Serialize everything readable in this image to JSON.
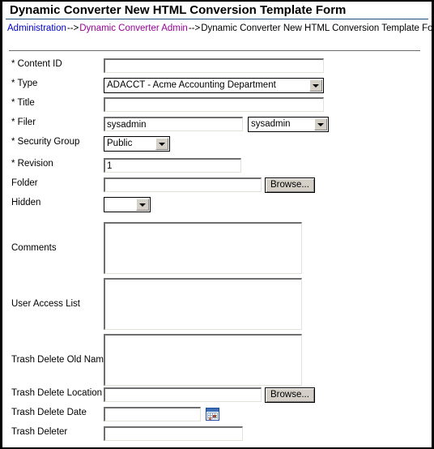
{
  "window": {
    "title": "Dynamic Converter New HTML Conversion Template Form",
    "accent_rule_color": "#1f4e79"
  },
  "breadcrumb": {
    "items": [
      {
        "label": "Administration",
        "state": "link",
        "color": "#0000cc"
      },
      {
        "label": "Dynamic Converter Admin",
        "state": "visited",
        "color": "#990099"
      },
      {
        "label": "Dynamic Converter New HTML Conversion Template Form",
        "state": "current",
        "color": "#000000"
      }
    ],
    "separator": "-->"
  },
  "form": {
    "required_marker": "*",
    "fields": [
      {
        "label": "* Content ID",
        "name": "content-id",
        "type": "text",
        "value": "",
        "placeholder": ""
      },
      {
        "label": "* Type",
        "name": "type",
        "type": "select",
        "value": "ADACCT - Acme Accounting Department"
      },
      {
        "label": "* Title",
        "name": "title",
        "type": "text",
        "value": "",
        "placeholder": ""
      },
      {
        "label": "* Filer",
        "name": "filer",
        "type": "text",
        "value": "sysadmin"
      },
      {
        "label": "* Filer",
        "name": "filer-select",
        "type": "select",
        "value": "sysadmin"
      },
      {
        "label": "* Security Group",
        "name": "security-group",
        "type": "select",
        "value": "Public"
      },
      {
        "label": "* Revision",
        "name": "revision",
        "type": "text",
        "value": "1"
      },
      {
        "label": "Folder",
        "name": "folder",
        "type": "text",
        "value": "",
        "button": "Browse..."
      },
      {
        "label": "Hidden",
        "name": "hidden",
        "type": "select",
        "value": ""
      },
      {
        "label": "Comments",
        "name": "comments",
        "type": "textarea",
        "value": ""
      },
      {
        "label": "User Access List",
        "name": "user-access-list",
        "type": "textarea",
        "value": ""
      },
      {
        "label": "Trash Delete Old Name",
        "name": "trash-delete-old-name",
        "type": "textarea",
        "value": ""
      },
      {
        "label": "Trash Delete Location",
        "name": "trash-delete-location",
        "type": "text",
        "value": "",
        "button": "Browse..."
      },
      {
        "label": "Trash Delete Date",
        "name": "trash-delete-date",
        "type": "text",
        "value": "",
        "icon": "calendar-icon"
      },
      {
        "label": "Trash Deleter",
        "name": "trash-deleter",
        "type": "text",
        "value": ""
      }
    ]
  },
  "labels": {
    "content_id": "* Content ID",
    "type": "* Type",
    "title": "* Title",
    "filer": "* Filer",
    "security_group": "* Security Group",
    "revision": "* Revision",
    "folder": "Folder",
    "hidden": "Hidden",
    "comments": "Comments",
    "user_access_list": "User Access List",
    "trash_delete_old_name": "Trash Delete Old Name",
    "trash_delete_location": "Trash Delete Location",
    "trash_delete_date": "Trash Delete Date",
    "trash_deleter": "Trash Deleter"
  },
  "values": {
    "content_id": "",
    "type": "ADACCT - Acme Accounting Department",
    "title": "",
    "filer_text": "sysadmin",
    "filer_select": "sysadmin",
    "security_group": "Public",
    "revision": "1",
    "folder": "",
    "hidden": "",
    "comments": "",
    "user_access_list": "",
    "trash_delete_old_name": "",
    "trash_delete_location": "",
    "trash_delete_date": "",
    "trash_deleter": ""
  },
  "buttons": {
    "browse_folder": "Browse...",
    "browse_trash_location": "Browse..."
  }
}
